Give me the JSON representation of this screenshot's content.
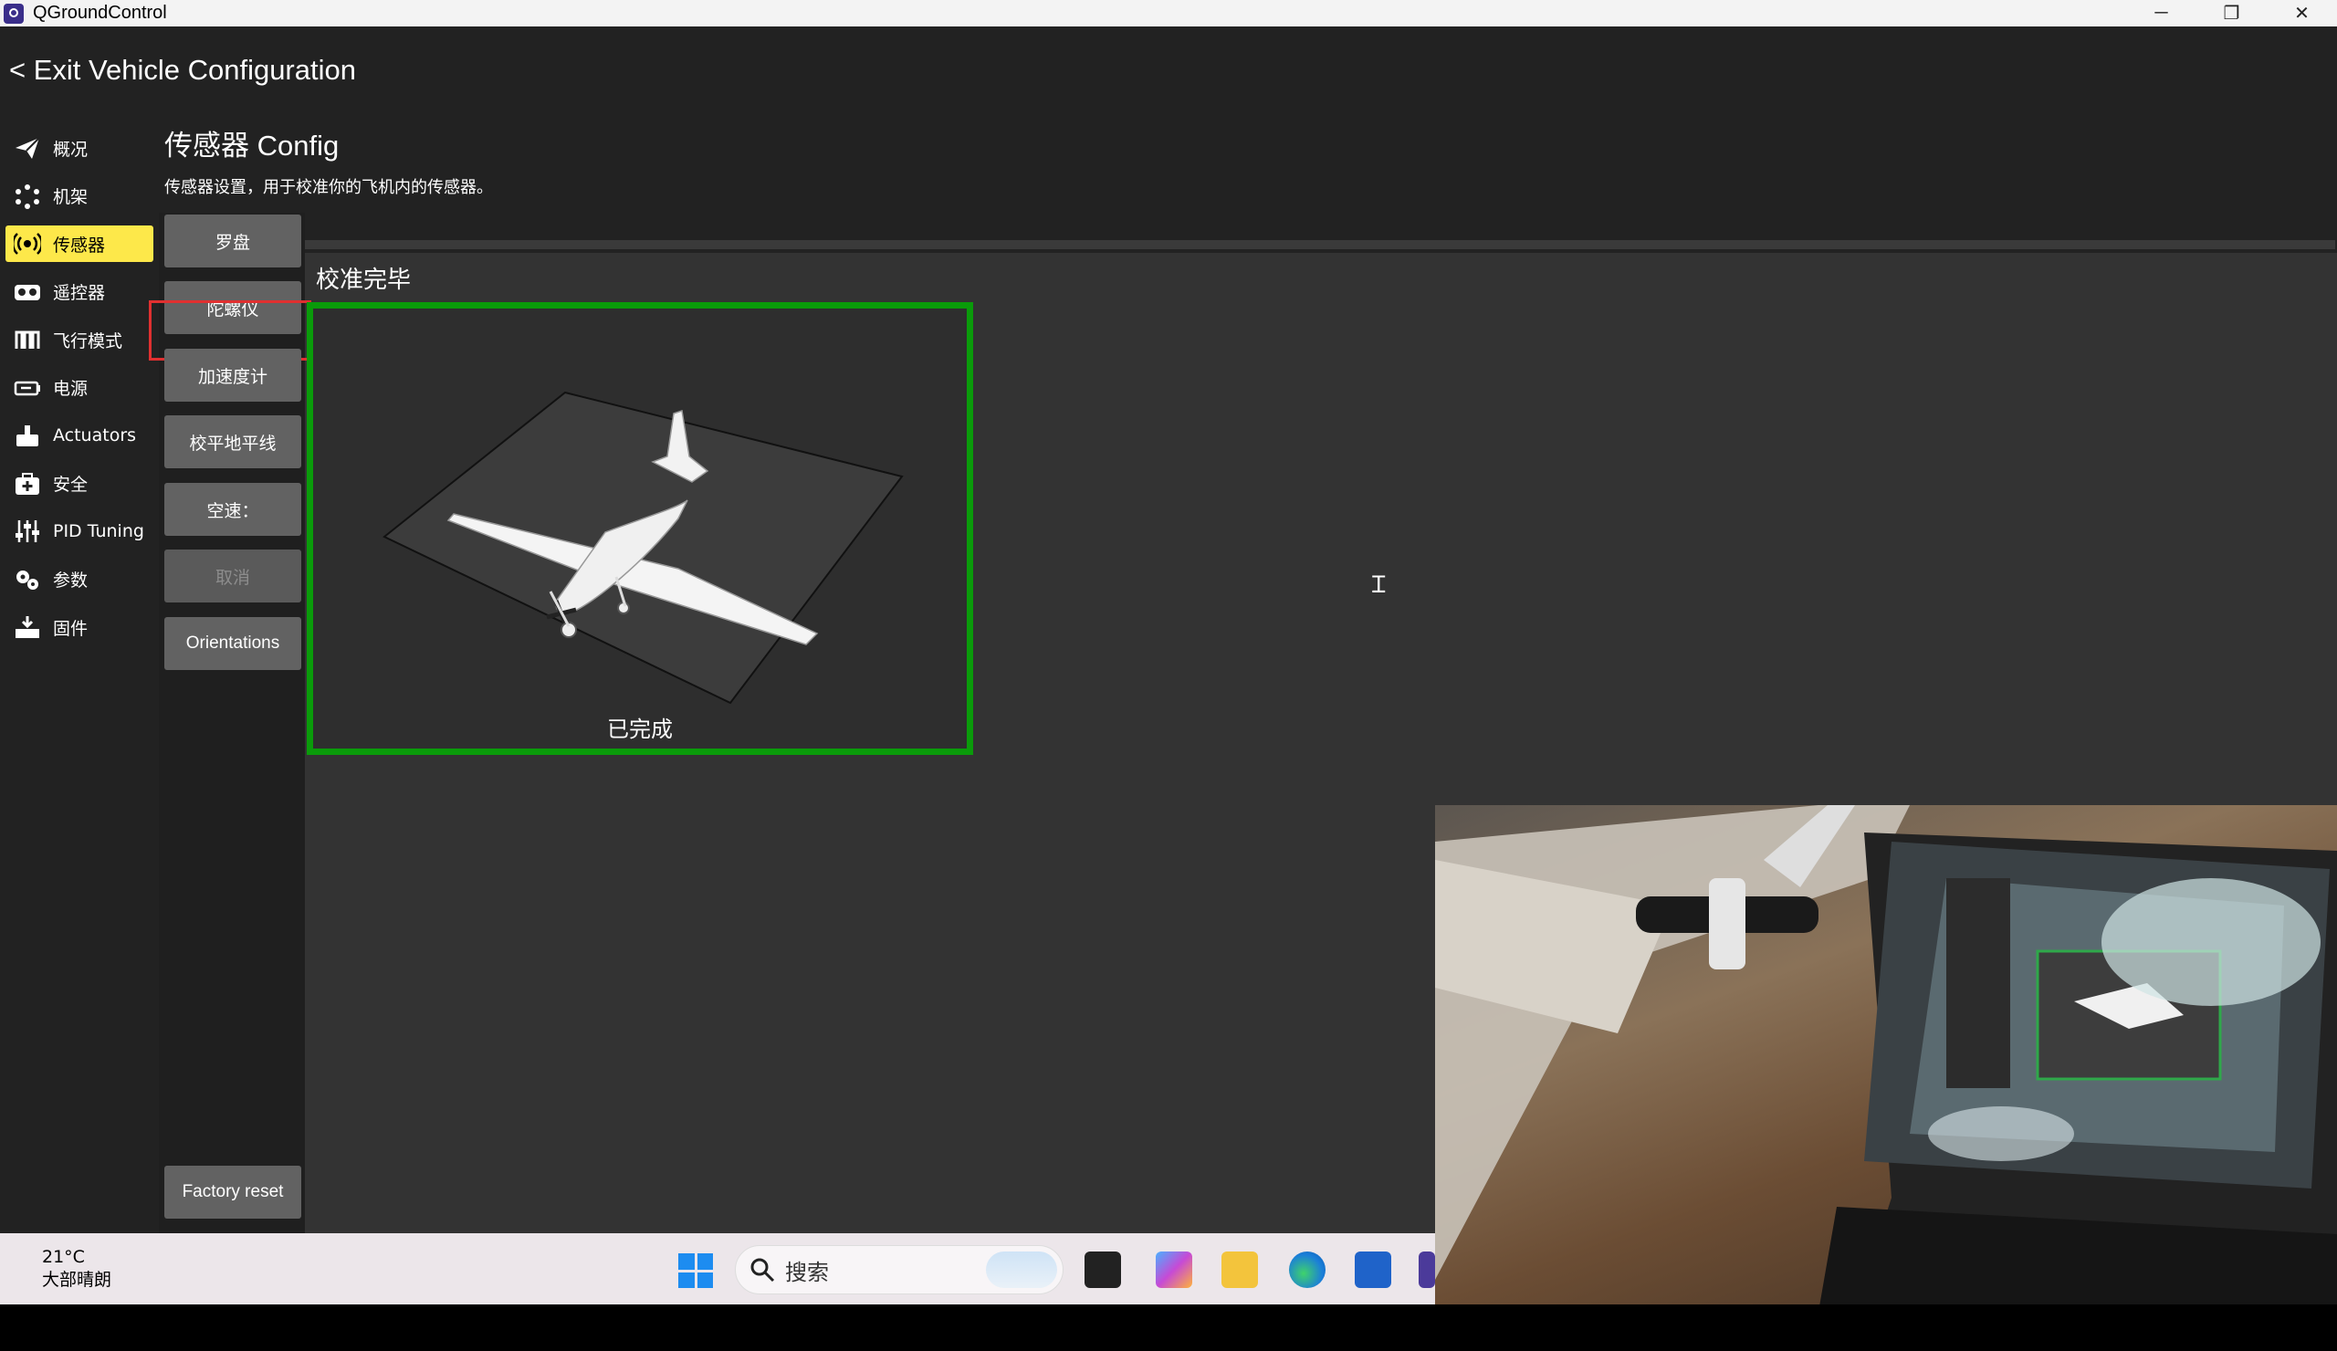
{
  "window": {
    "title": "QGroundControl",
    "controls": [
      "─",
      "❐",
      "✕"
    ]
  },
  "header": {
    "exit_label": "< Exit Vehicle Configuration"
  },
  "sidebar": {
    "items": [
      {
        "label": "概况",
        "icon": "paper-plane-icon"
      },
      {
        "label": "机架",
        "icon": "frame-dots-icon"
      },
      {
        "label": "传感器",
        "icon": "sensor-radio-icon",
        "active": true
      },
      {
        "label": "遥控器",
        "icon": "remote-controller-icon"
      },
      {
        "label": "飞行模式",
        "icon": "flight-mode-wave-icon"
      },
      {
        "label": "电源",
        "icon": "battery-icon"
      },
      {
        "label": "Actuators",
        "icon": "actuator-icon"
      },
      {
        "label": "安全",
        "icon": "safety-kit-icon"
      },
      {
        "label": "PID Tuning",
        "icon": "sliders-icon"
      },
      {
        "label": "参数",
        "icon": "gears-icon"
      },
      {
        "label": "固件",
        "icon": "firmware-download-icon"
      }
    ],
    "active_color": "#fde84a"
  },
  "content": {
    "title": "传感器 Config",
    "description": "传感器设置，用于校准你的飞机内的传感器。"
  },
  "sensor_buttons": {
    "compass": "罗盘",
    "gyro": "陀螺仪",
    "accel": "加速度计",
    "level": "校平地平线",
    "airspeed": "空速：",
    "cancel": "取消",
    "orientations": "Orientations",
    "factory_reset": "Factory reset"
  },
  "calibration": {
    "status_title": "校准完毕",
    "done_label": "已完成",
    "border_color": "#0a9b0a",
    "highlight_color": "#e03030"
  },
  "taskbar": {
    "temperature": "21°C",
    "weather": "大部晴朗",
    "search_placeholder": "搜索"
  }
}
